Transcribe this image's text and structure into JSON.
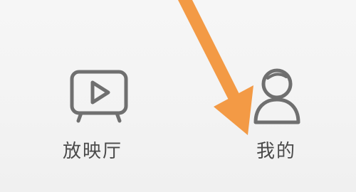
{
  "bottom_nav": {
    "items": [
      {
        "label": "放映厅",
        "icon": "tv-play-icon"
      },
      {
        "label": "我的",
        "icon": "person-icon"
      }
    ]
  },
  "annotation": {
    "arrow_color": "#f39a45",
    "arrow_icon": "arrow-down-icon"
  }
}
